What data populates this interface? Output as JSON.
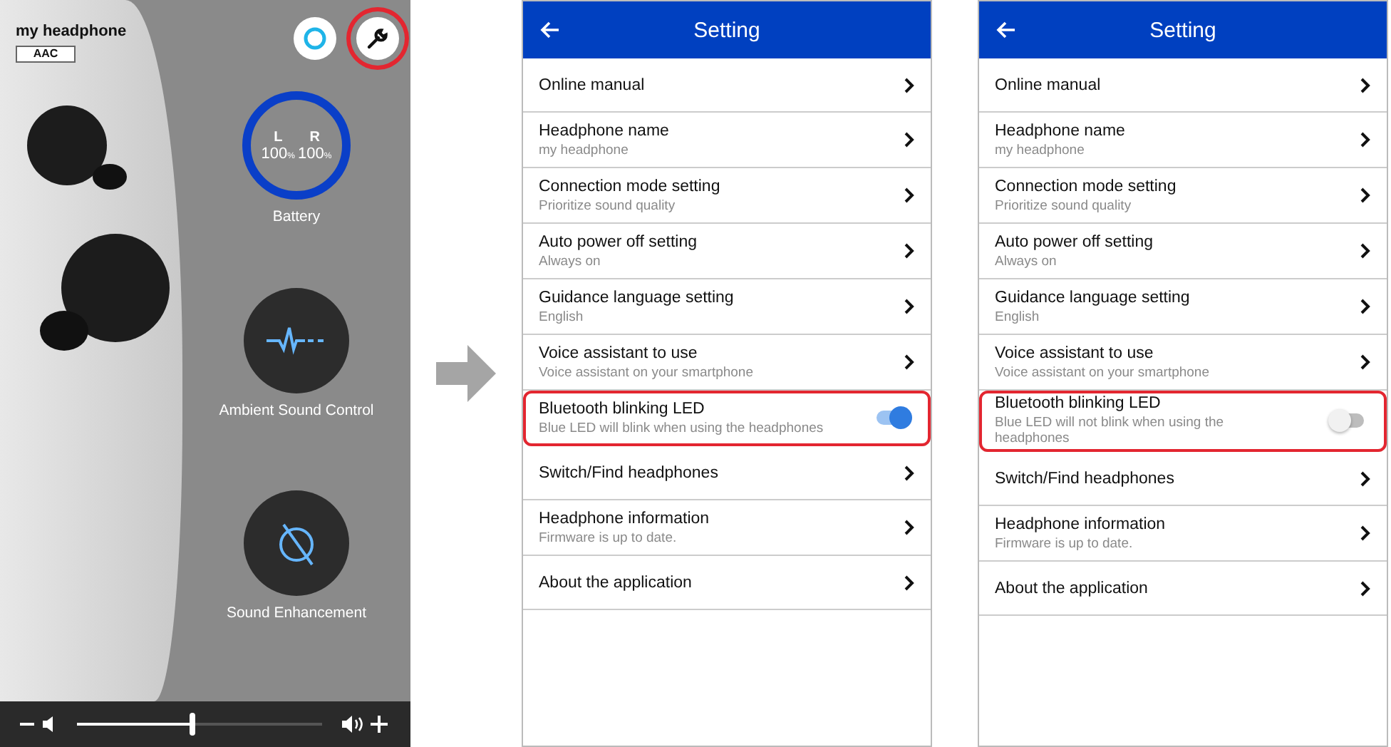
{
  "headphone": {
    "name": "my headphone",
    "codec": "AAC"
  },
  "top_buttons": [
    {
      "kind": "assistant",
      "highlighted": false
    },
    {
      "kind": "settings",
      "highlighted": true
    }
  ],
  "battery": {
    "label": "Battery",
    "sides": [
      {
        "side": "L",
        "value": "100",
        "unit": "%"
      },
      {
        "side": "R",
        "value": "100",
        "unit": "%"
      }
    ]
  },
  "features": [
    {
      "kind": "ambient",
      "label": "Ambient Sound Control"
    },
    {
      "kind": "enhancement",
      "label": "Sound Enhancement"
    }
  ],
  "volume": {
    "level": 0.48
  },
  "screens": [
    {
      "title": "Setting",
      "items": [
        {
          "kind": "link",
          "title": "Online manual",
          "highlighted": false
        },
        {
          "kind": "link",
          "title": "Headphone name",
          "subtitle": "my headphone",
          "highlighted": false
        },
        {
          "kind": "link",
          "title": "Connection mode setting",
          "subtitle": "Prioritize sound quality",
          "highlighted": false
        },
        {
          "kind": "link",
          "title": "Auto power off setting",
          "subtitle": "Always on",
          "highlighted": false
        },
        {
          "kind": "link",
          "title": "Guidance language setting",
          "subtitle": "English",
          "highlighted": false
        },
        {
          "kind": "link",
          "title": "Voice assistant to use",
          "subtitle": "Voice assistant on your smartphone",
          "highlighted": false
        },
        {
          "kind": "toggle",
          "title": "Bluetooth blinking LED",
          "subtitle": "Blue LED will blink when using the headphones",
          "on": true,
          "highlighted": true
        },
        {
          "kind": "link",
          "title": "Switch/Find headphones",
          "highlighted": false
        },
        {
          "kind": "link",
          "title": "Headphone information",
          "subtitle": "Firmware is up to date.",
          "highlighted": false
        },
        {
          "kind": "link",
          "title": "About the application",
          "highlighted": false
        }
      ]
    },
    {
      "title": "Setting",
      "items": [
        {
          "kind": "link",
          "title": "Online manual",
          "highlighted": false
        },
        {
          "kind": "link",
          "title": "Headphone name",
          "subtitle": "my headphone",
          "highlighted": false
        },
        {
          "kind": "link",
          "title": "Connection mode setting",
          "subtitle": "Prioritize sound quality",
          "highlighted": false
        },
        {
          "kind": "link",
          "title": "Auto power off setting",
          "subtitle": "Always on",
          "highlighted": false
        },
        {
          "kind": "link",
          "title": "Guidance language setting",
          "subtitle": "English",
          "highlighted": false
        },
        {
          "kind": "link",
          "title": "Voice assistant to use",
          "subtitle": "Voice assistant on your smartphone",
          "highlighted": false
        },
        {
          "kind": "toggle",
          "title": "Bluetooth blinking LED",
          "subtitle": "Blue LED will not blink when using the headphones",
          "on": false,
          "highlighted": true
        },
        {
          "kind": "link",
          "title": "Switch/Find headphones",
          "highlighted": false
        },
        {
          "kind": "link",
          "title": "Headphone information",
          "subtitle": "Firmware is up to date.",
          "highlighted": false
        },
        {
          "kind": "link",
          "title": "About the application",
          "highlighted": false
        }
      ]
    }
  ]
}
